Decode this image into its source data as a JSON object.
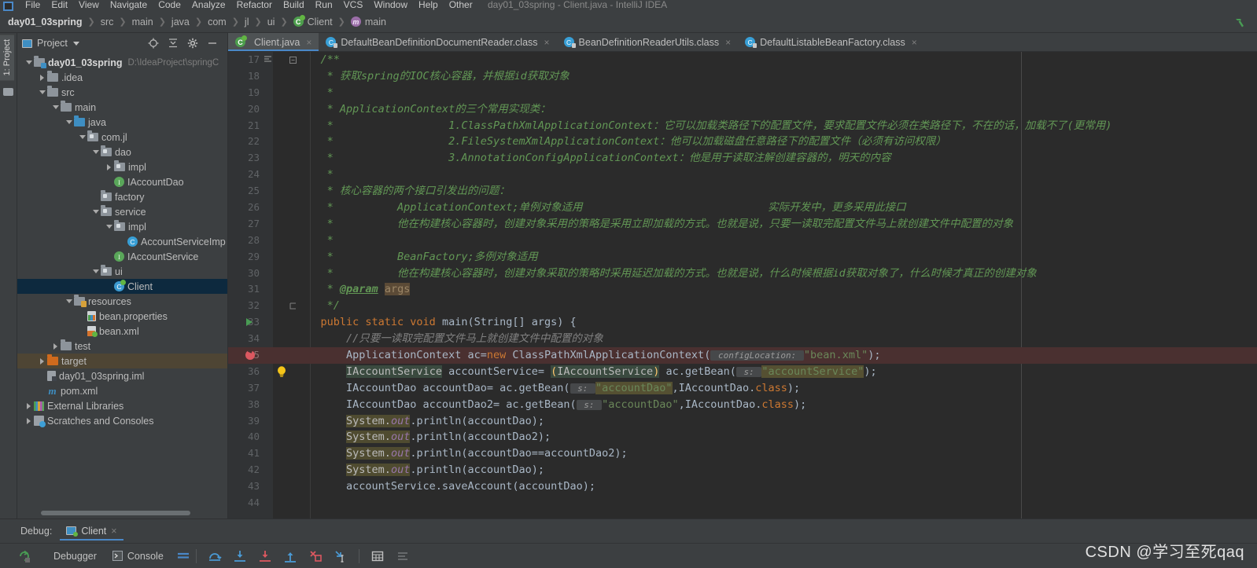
{
  "window": {
    "title": "day01_03spring - Client.java - IntelliJ IDEA",
    "menus": [
      "File",
      "Edit",
      "View",
      "Navigate",
      "Code",
      "Analyze",
      "Refactor",
      "Build",
      "Run",
      "VCS",
      "Window",
      "Help",
      "Other"
    ]
  },
  "breadcrumb": {
    "items": [
      {
        "label": "day01_03spring",
        "icon": "none"
      },
      {
        "label": "src",
        "icon": "none"
      },
      {
        "label": "main",
        "icon": "none"
      },
      {
        "label": "java",
        "icon": "none"
      },
      {
        "label": "com",
        "icon": "none"
      },
      {
        "label": "jl",
        "icon": "none"
      },
      {
        "label": "ui",
        "icon": "none"
      },
      {
        "label": "Client",
        "icon": "class-runnable-icon"
      },
      {
        "label": "main",
        "icon": "method-icon"
      }
    ],
    "build_icon": "hammer-icon"
  },
  "left_strip": {
    "project_tab": "1: Project"
  },
  "project_panel": {
    "title": "Project",
    "toolbar_icons": [
      "locate-icon",
      "collapse-all-icon",
      "settings-gear-icon",
      "hide-icon"
    ],
    "tree": [
      {
        "label": "day01_03spring",
        "path": "D:\\IdeaProject\\springC",
        "indent": 0,
        "twisty": "down",
        "icon": "module-folder-icon",
        "bold": true
      },
      {
        "label": ".idea",
        "path": "",
        "indent": 1,
        "twisty": "right",
        "icon": "folder-icon"
      },
      {
        "label": "src",
        "path": "",
        "indent": 1,
        "twisty": "down",
        "icon": "folder-icon"
      },
      {
        "label": "main",
        "path": "",
        "indent": 2,
        "twisty": "down",
        "icon": "folder-icon"
      },
      {
        "label": "java",
        "path": "",
        "indent": 3,
        "twisty": "down",
        "icon": "source-folder-icon"
      },
      {
        "label": "com.jl",
        "path": "",
        "indent": 4,
        "twisty": "down",
        "icon": "package-icon"
      },
      {
        "label": "dao",
        "path": "",
        "indent": 5,
        "twisty": "down",
        "icon": "package-icon"
      },
      {
        "label": "impl",
        "path": "",
        "indent": 6,
        "twisty": "right",
        "icon": "package-icon"
      },
      {
        "label": "IAccountDao",
        "path": "",
        "indent": 6,
        "twisty": "none",
        "icon": "interface-icon"
      },
      {
        "label": "factory",
        "path": "",
        "indent": 5,
        "twisty": "none",
        "icon": "package-icon"
      },
      {
        "label": "service",
        "path": "",
        "indent": 5,
        "twisty": "down",
        "icon": "package-icon"
      },
      {
        "label": "impl",
        "path": "",
        "indent": 6,
        "twisty": "down",
        "icon": "package-icon"
      },
      {
        "label": "AccountServiceImp",
        "path": "",
        "indent": 7,
        "twisty": "none",
        "icon": "class-icon"
      },
      {
        "label": "IAccountService",
        "path": "",
        "indent": 6,
        "twisty": "none",
        "icon": "interface-icon"
      },
      {
        "label": "ui",
        "path": "",
        "indent": 5,
        "twisty": "down",
        "icon": "package-icon"
      },
      {
        "label": "Client",
        "path": "",
        "indent": 6,
        "twisty": "none",
        "icon": "class-runnable-icon",
        "selected": true
      },
      {
        "label": "resources",
        "path": "",
        "indent": 3,
        "twisty": "down",
        "icon": "resources-folder-icon"
      },
      {
        "label": "bean.properties",
        "path": "",
        "indent": 4,
        "twisty": "none",
        "icon": "properties-file-icon"
      },
      {
        "label": "bean.xml",
        "path": "",
        "indent": 4,
        "twisty": "none",
        "icon": "xml-file-icon"
      },
      {
        "label": "test",
        "path": "",
        "indent": 2,
        "twisty": "right",
        "icon": "folder-icon"
      },
      {
        "label": "target",
        "path": "",
        "indent": 1,
        "twisty": "right",
        "icon": "excluded-folder-icon",
        "highlight": true
      },
      {
        "label": "day01_03spring.iml",
        "path": "",
        "indent": 1,
        "twisty": "none",
        "icon": "iml-file-icon"
      },
      {
        "label": "pom.xml",
        "path": "",
        "indent": 1,
        "twisty": "none",
        "icon": "maven-file-icon"
      },
      {
        "label": "External Libraries",
        "path": "",
        "indent": 0,
        "twisty": "right",
        "icon": "libraries-icon"
      },
      {
        "label": "Scratches and Consoles",
        "path": "",
        "indent": 0,
        "twisty": "right",
        "icon": "scratches-icon"
      }
    ]
  },
  "editor_tabs": [
    {
      "label": "Client.java",
      "icon": "class-runnable-icon",
      "active": true,
      "close": "×"
    },
    {
      "label": "DefaultBeanDefinitionDocumentReader.class",
      "icon": "class-locked-icon",
      "active": false,
      "close": "×"
    },
    {
      "label": "BeanDefinitionReaderUtils.class",
      "icon": "class-locked-icon",
      "active": false,
      "close": "×"
    },
    {
      "label": "DefaultListableBeanFactory.class",
      "icon": "class-locked-icon",
      "active": false,
      "close": "×"
    }
  ],
  "code": {
    "first_line": 17,
    "lines": [
      {
        "n": 17,
        "text": "    /**",
        "gutter": "fold-open"
      },
      {
        "n": 18,
        "text": "     * 获取spring的IOC核心容器，并根据id获取对象"
      },
      {
        "n": 19,
        "text": "     *"
      },
      {
        "n": 20,
        "text": "     * ApplicationContext的三个常用实现类："
      },
      {
        "n": 21,
        "text": "     *                  1.ClassPathXmlApplicationContext：它可以加载类路径下的配置文件，要求配置文件必须在类路径下，不在的话，加载不了(更常用)"
      },
      {
        "n": 22,
        "text": "     *                  2.FileSystemXmlApplicationContext：他可以加载磁盘任意路径下的配置文件（必须有访问权限）"
      },
      {
        "n": 23,
        "text": "     *                  3.AnnotationConfigApplicationContext：他是用于读取注解创建容器的，明天的内容"
      },
      {
        "n": 24,
        "text": "     *"
      },
      {
        "n": 25,
        "text": "     * 核心容器的两个接口引发出的问题："
      },
      {
        "n": 26,
        "text": "     *          ApplicationContext;单例对象适用                             实际开发中，更多采用此接口"
      },
      {
        "n": 27,
        "text": "     *          他在构建核心容器时，创建对象采用的策略是采用立即加载的方式。也就是说，只要一读取完配置文件马上就创建文件中配置的对象"
      },
      {
        "n": 28,
        "text": "     *"
      },
      {
        "n": 29,
        "text": "     *          BeanFactory;多例对象适用"
      },
      {
        "n": 30,
        "text": "     *          他在构建核心容器时，创建对象采取的策略时采用延迟加载的方式。也就是说，什么时候根据id获取对象了，什么时候才真正的创建对象"
      },
      {
        "n": 31,
        "text": "     * @param args"
      },
      {
        "n": 32,
        "text": "     */",
        "gutter": "fold-close"
      },
      {
        "n": 33,
        "text": "    public static void main(String[] args) {",
        "gutter": "run"
      },
      {
        "n": 34,
        "text": "        //只要一读取完配置文件马上就创建文件中配置的对象"
      },
      {
        "n": 35,
        "text": "        ApplicationContext ac=new ClassPathXmlApplicationContext( configLocation: \"bean.xml\");",
        "gutter": "breakpoint",
        "highlight": "red"
      },
      {
        "n": 36,
        "text": "        IAccountService accountService= (IAccountService) ac.getBean( s: \"accountService\");",
        "gutter": "bulb"
      },
      {
        "n": 37,
        "text": "        IAccountDao accountDao= ac.getBean( s: \"accountDao\",IAccountDao.class);"
      },
      {
        "n": 38,
        "text": "        IAccountDao accountDao2= ac.getBean( s: \"accountDao\",IAccountDao.class);"
      },
      {
        "n": 39,
        "text": "        System.out.println(accountDao);"
      },
      {
        "n": 40,
        "text": "        System.out.println(accountDao2);"
      },
      {
        "n": 41,
        "text": "        System.out.println(accountDao==accountDao2);"
      },
      {
        "n": 42,
        "text": "        System.out.println(accountDao);"
      },
      {
        "n": 43,
        "text": "        accountService.saveAccount(accountDao);"
      },
      {
        "n": 44,
        "text": ""
      }
    ],
    "inlay_hints": {
      "config": "configLocation:",
      "s": "s:"
    }
  },
  "debug_panel": {
    "label": "Debug:",
    "session_tab": "Client",
    "session_close": "×",
    "buttons": [
      {
        "label": "Debugger",
        "icon": "debugger-icon"
      },
      {
        "label": "Console",
        "icon": "console-icon"
      }
    ],
    "toolbar_icons": [
      "rerun-icon",
      "layout-icon",
      "step-over-icon",
      "step-into-icon",
      "force-step-into-icon",
      "step-out-icon",
      "drop-frame-icon",
      "run-to-cursor-icon",
      "evaluate-icon",
      "mute-breakpoints-icon"
    ]
  },
  "watermark": "CSDN @学习至死qaq",
  "colors": {
    "panel_bg": "#3c3f41",
    "editor_bg": "#2b2b2b",
    "gutter_bg": "#313335",
    "accent": "#4a88c7",
    "selection": "#0d293e",
    "comment": "#629755",
    "keyword": "#cc7832",
    "string": "#6a8759",
    "breakpoint_line": "#4a3030"
  }
}
